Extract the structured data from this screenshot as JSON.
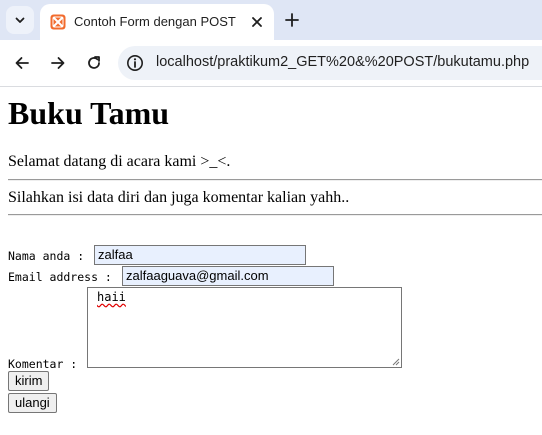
{
  "browser": {
    "tab_title": "Contoh Form dengan POST",
    "url": "localhost/praktikum2_GET%20&%20POST/bukutamu.php"
  },
  "page": {
    "heading": "Buku Tamu",
    "welcome": "Selamat datang di acara kami >_<.",
    "instruction": "Silahkan isi data diri dan juga komentar kalian yahh..",
    "form": {
      "name_label": "Nama anda :",
      "name_value": "zalfaa",
      "email_label": "Email address :",
      "email_value": "zalfaaguava@gmail.com",
      "comment_label": "Komentar :",
      "comment_value": "haii",
      "submit_label": "kirim",
      "reset_label": "ulangi"
    }
  },
  "icons": {
    "tab_dropdown": "chevron-down-icon",
    "favicon": "xampp-icon",
    "tab_close": "close-icon",
    "new_tab": "plus-icon",
    "back": "arrow-left-icon",
    "forward": "arrow-right-icon",
    "reload": "reload-icon",
    "site_info": "info-icon"
  },
  "colors": {
    "favicon": "#f26b2d",
    "tabbar": "#dfe6f5",
    "omnibox": "#eef2f8",
    "autofill": "#e8f0fe"
  }
}
